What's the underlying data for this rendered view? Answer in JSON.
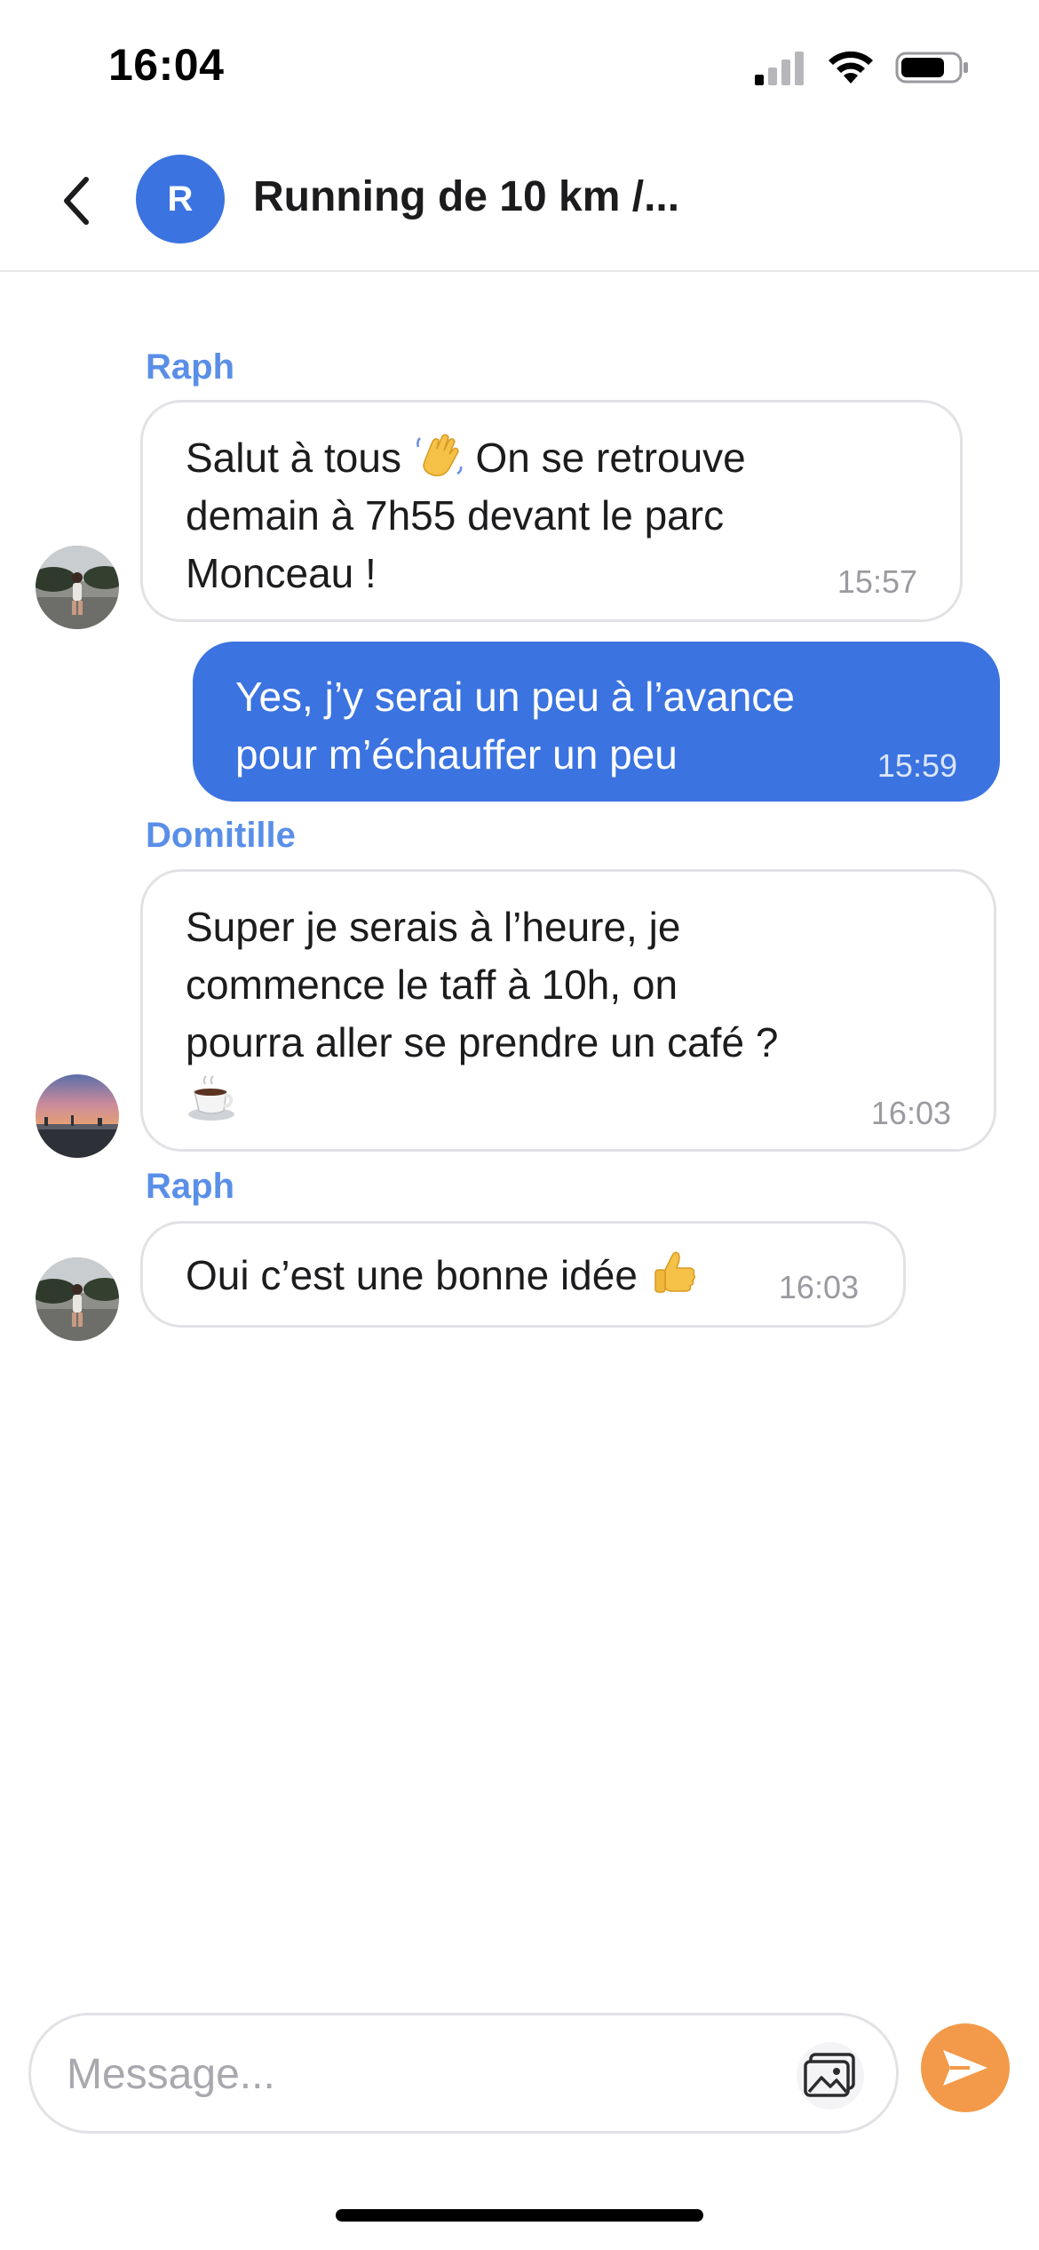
{
  "status_bar": {
    "time": "16:04",
    "icons": [
      "cellular-signal-icon",
      "wifi-icon",
      "battery-icon"
    ]
  },
  "header": {
    "back_icon": "chevron-left-icon",
    "avatar_initial": "R",
    "title": "Running de 10 km /..."
  },
  "messages": [
    {
      "sender": "Raph",
      "direction": "incoming",
      "lines": [
        "Salut à tous",
        "On se retrouve",
        "demain à 7h55 devant le parc",
        "Monceau !"
      ],
      "emoji": "waving-hand-emoji",
      "time": "15:57"
    },
    {
      "direction": "outgoing",
      "lines": [
        "Yes, j’y serai un peu à l’avance",
        "pour m’échauffer un peu"
      ],
      "time": "15:59"
    },
    {
      "sender": "Domitille",
      "direction": "incoming",
      "lines": [
        "Super je serais à l’heure, je",
        "commence le taff à 10h, on",
        "pourra aller se prendre un café ?"
      ],
      "emoji": "coffee-cup-emoji",
      "time": "16:03"
    },
    {
      "sender": "Raph",
      "direction": "incoming",
      "lines": [
        "Oui c’est une bonne idée"
      ],
      "emoji": "thumbs-up-emoji",
      "time": "16:03"
    }
  ],
  "composer": {
    "placeholder": "Message...",
    "attach_icon": "image-icon",
    "send_icon": "send-arrow-icon"
  },
  "colors": {
    "accent_blue": "#3b73e0",
    "sender_name": "#5a8fe8",
    "send_orange": "#f29a4a",
    "bubble_border": "#e2e2e6"
  }
}
